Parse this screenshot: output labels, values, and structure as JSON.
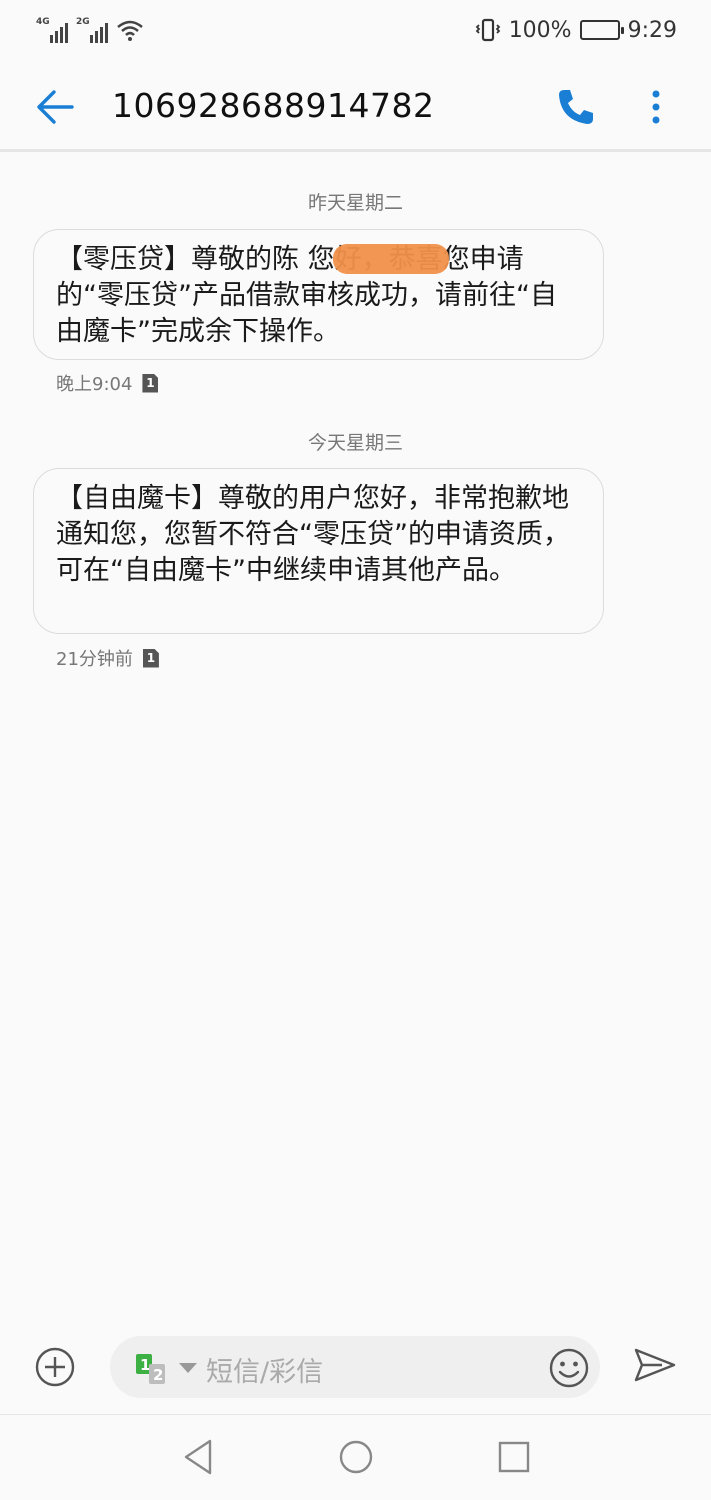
{
  "status_bar": {
    "network1": "4G",
    "network2": "2G",
    "battery": "100%",
    "time": "9:29"
  },
  "header": {
    "title": "106928688914782"
  },
  "messages": [
    {
      "date": "昨天星期二",
      "text": "【零压贷】尊敬的陈  您好，恭喜您申请的“零压贷”产品借款审核成功，请前往“自由魔卡”完成余下操作。",
      "time": "晚上9:04",
      "sim": "1"
    },
    {
      "date": "今天星期三",
      "text": "【自由魔卡】尊敬的用户您好，非常抱歉地通知您，您暂不符合“零压贷”的申请资质，可在“自由魔卡”中继续申请其他产品。",
      "time": "21分钟前",
      "sim": "1"
    }
  ],
  "input": {
    "placeholder": "短信/彩信",
    "sim_primary": "1",
    "sim_secondary": "2"
  },
  "colors": {
    "accent": "#1a7fd4",
    "sim_green": "#3cb043",
    "redaction": "#f0904a"
  },
  "icons": {
    "back": "arrow-left-icon",
    "call": "phone-icon",
    "more": "more-vertical-icon",
    "add": "plus-circle-icon",
    "emoji": "smiley-icon",
    "send": "send-icon"
  }
}
